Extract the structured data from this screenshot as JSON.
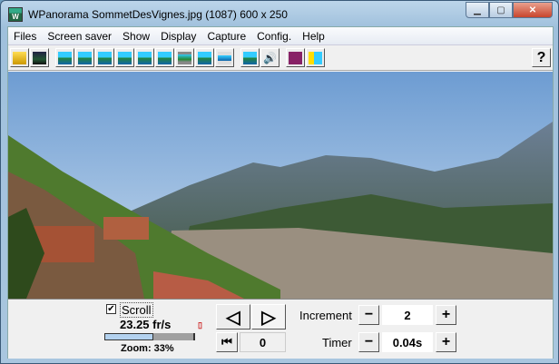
{
  "window": {
    "title": "WPanorama  SommetDesVignes.jpg   (1087) 600 x 250",
    "icon_letter": "W",
    "buttons": [
      "minimize",
      "maximize",
      "close"
    ]
  },
  "menu": [
    "Files",
    "Screen saver",
    "Show",
    "Display",
    "Capture",
    "Config.",
    "Help"
  ],
  "toolbar": {
    "icons": [
      "open-icon",
      "picture-icon",
      "fit-icon",
      "move-icon",
      "up-left-icon",
      "up-right-icon",
      "down-left-icon",
      "down-right-icon",
      "film-icon",
      "landscape-icon",
      "strip-icon",
      "center-icon",
      "sound-icon",
      "book-icon",
      "help-image-icon"
    ],
    "help_label": "?"
  },
  "controls": {
    "scroll_label": "Scroll",
    "scroll_checked": true,
    "fps": "23.25 fr/s",
    "zoom": "Zoom: 33%",
    "zoom_slider_fraction": 0.55,
    "position": "0",
    "increment_label": "Increment",
    "increment_value": "2",
    "timer_label": "Timer",
    "timer_value": "0.04s",
    "minus": "−",
    "plus": "+"
  }
}
